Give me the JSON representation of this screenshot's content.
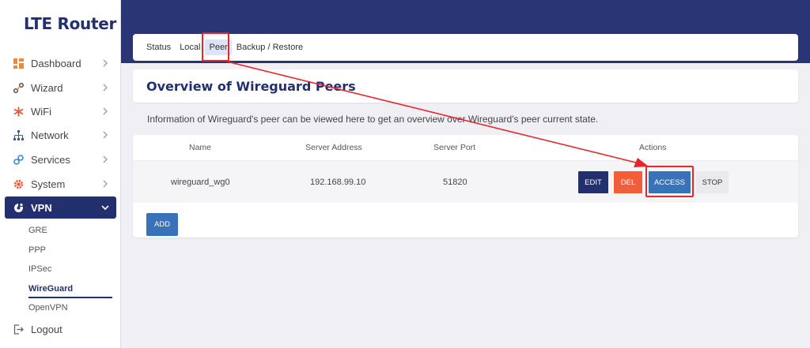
{
  "sidebar": {
    "brand": "LTE Router",
    "items": [
      {
        "label": "Dashboard",
        "icon": "dashboard-icon"
      },
      {
        "label": "Wizard",
        "icon": "wizard-icon"
      },
      {
        "label": "WiFi",
        "icon": "wifi-icon"
      },
      {
        "label": "Network",
        "icon": "network-icon"
      },
      {
        "label": "Services",
        "icon": "services-icon"
      },
      {
        "label": "System",
        "icon": "system-icon"
      },
      {
        "label": "VPN",
        "icon": "vpn-icon"
      }
    ],
    "vpn_sub": [
      "GRE",
      "PPP",
      "IPSec",
      "WireGuard",
      "OpenVPN"
    ],
    "logout": "Logout"
  },
  "tabs": [
    "Status",
    "Local",
    "Peer",
    "Backup / Restore"
  ],
  "page": {
    "title": "Overview of Wireguard Peers",
    "info": "Information of Wireguard's peer can be viewed here to get an overview over Wireguard's peer current state."
  },
  "table": {
    "headers": {
      "name": "Name",
      "address": "Server Address",
      "port": "Server Port",
      "actions": "Actions"
    },
    "rows": [
      {
        "name": "wireguard_wg0",
        "address": "192.168.99.10",
        "port": "51820"
      }
    ]
  },
  "buttons": {
    "edit": "EDIT",
    "del": "DEL",
    "access": "ACCESS",
    "stop": "STOP",
    "add": "ADD"
  },
  "colors": {
    "brand": "#23306e",
    "accent": "#3a72b8",
    "danger": "#f05e3a",
    "annotation": "#e6262b"
  }
}
